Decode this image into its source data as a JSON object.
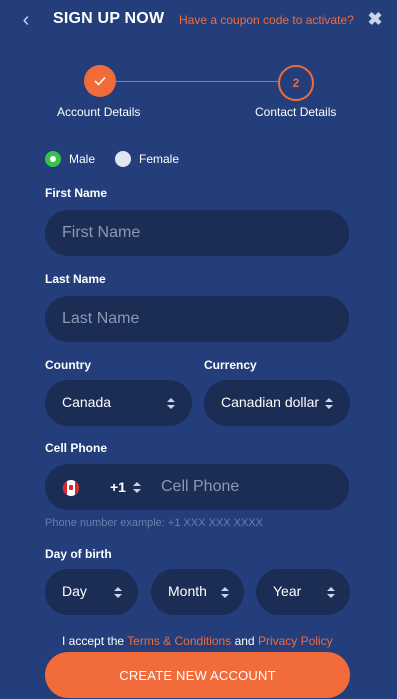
{
  "header": {
    "title": "SIGN UP NOW",
    "coupon_link": "Have a coupon code to activate?"
  },
  "stepper": {
    "step1_label": "Account Details",
    "step2_number": "2",
    "step2_label": "Contact Details",
    "current_step": 2
  },
  "gender": {
    "options": [
      "Male",
      "Female"
    ],
    "selected": "Male"
  },
  "first_name": {
    "label": "First Name",
    "placeholder": "First Name",
    "value": ""
  },
  "last_name": {
    "label": "Last Name",
    "placeholder": "Last Name",
    "value": ""
  },
  "country": {
    "label": "Country",
    "value": "Canada"
  },
  "currency": {
    "label": "Currency",
    "value": "Canadian dollar"
  },
  "cell_phone": {
    "label": "Cell Phone",
    "dial_code": "+1",
    "placeholder": "Cell Phone",
    "value": "",
    "hint": "Phone number example: +1 XXX XXX XXXX"
  },
  "dob": {
    "label": "Day of birth",
    "day": "Day",
    "month": "Month",
    "year": "Year"
  },
  "terms": {
    "prefix": "I accept the",
    "terms_link": "Terms & Conditions",
    "and": "and",
    "privacy_link": "Privacy Policy"
  },
  "submit_label": "CREATE NEW ACCOUNT",
  "colors": {
    "background": "#233e7a",
    "field": "#1b2c55",
    "accent": "#f26b3a",
    "radio_selected": "#3cc04d"
  },
  "icons": {
    "back": "chevron-left-icon",
    "close": "close-icon",
    "check": "check-icon",
    "flag": "canada-flag-icon",
    "select_arrows": "sort-arrows-icon"
  }
}
